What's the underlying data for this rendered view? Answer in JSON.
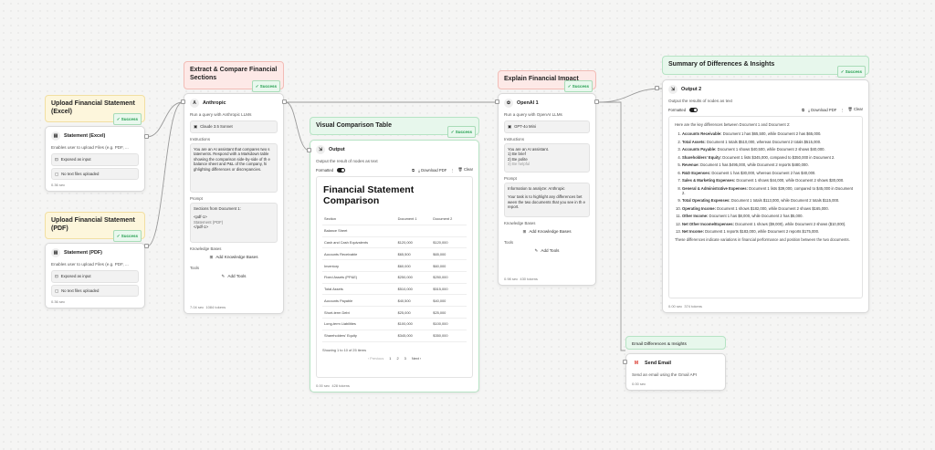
{
  "upload_excel": {
    "header": "Upload Financial Statement (Excel)",
    "badge": "✓ Success",
    "title": "Statement (Excel)",
    "desc": "Enables user to upload Files (e.g. PDF, ...",
    "opt1": "Exposed as input",
    "opt2": "No text files uploaded",
    "time": "0.36 sec"
  },
  "upload_pdf": {
    "header": "Upload Financial Statement (PDF)",
    "badge": "✓ Success",
    "title": "Statement (PDF)",
    "desc": "Enables user to upload Files (e.g. PDF, ...",
    "opt1": "Exposed as input",
    "opt2": "No text files uploaded",
    "time": "0.36 sec"
  },
  "extract": {
    "header": "Extract & Compare Financial Sections",
    "badge": "✓ Success",
    "title": "Anthropic",
    "desc": "Run a query with Anthropic LLMs",
    "model": "Claude 3.5 Sonnet",
    "instructions_label": "Instructions",
    "instructions": "You are an AI assistant that compares two s tatements. Respond with a Markdown table showing the comparison side-by-side of th e balance sheet and P&L of the company, hi ghlighting differences or discrepancies.",
    "prompt_label": "Prompt",
    "prompt_lines": [
      "Sections from Document 1:",
      "<pdf-1>",
      "Statement (PDF)",
      "</pdf-1>"
    ],
    "kb_label": "Knowledge Bases",
    "kb_btn": "Add Knowledge Bases",
    "tools_label": "Tools",
    "tools_btn": "Add Tools",
    "time": "7.04 sec",
    "tokens": "1084 tokens"
  },
  "visual": {
    "header": "Visual Comparison Table",
    "badge": "✓ Success",
    "title": "Output",
    "desc": "Output the result of nodes as text",
    "formatted": "Formatted",
    "download": "Download PDF",
    "clear": "Clear",
    "doc_title": "Financial Statement Comparison",
    "columns": [
      "Section",
      "Document 1",
      "Document 2"
    ],
    "rows": [
      [
        "Balance Sheet",
        "",
        ""
      ],
      [
        "Cash and Cash Equivalents",
        "$120,000",
        "$120,000"
      ],
      [
        "Accounts Receivable",
        "$65,500",
        "$65,000"
      ],
      [
        "Inventory",
        "$60,000",
        "$60,000"
      ],
      [
        "Fixed Assets (PP&E)",
        "$250,000",
        "$250,000"
      ],
      [
        "Total Assets",
        "$510,000",
        "$515,000"
      ],
      [
        "Accounts Payable",
        "$40,500",
        "$40,000"
      ],
      [
        "Short-term Debt",
        "$25,000",
        "$25,000"
      ],
      [
        "Long-term Liabilities",
        "$100,000",
        "$100,000"
      ],
      [
        "Shareholders' Equity",
        "$345,000",
        "$350,000"
      ]
    ],
    "showing": "Showing 1 to 10 of 25 items",
    "prev": "‹ Previous",
    "pages": [
      "1",
      "2",
      "3"
    ],
    "next": "Next ›",
    "time": "0.00 sec",
    "tokens": "428 tokens"
  },
  "explain": {
    "header": "Explain Financial Impact",
    "badge": "✓ Success",
    "title": "OpenAI 1",
    "desc": "Run a query with OpenAI LLMs",
    "model": "GPT-4o Mini",
    "instructions_label": "Instructions",
    "instructions_lines": [
      "You are an AI assistant.",
      "1) Be brief",
      "2) Be polite",
      "3) Be helpful"
    ],
    "prompt_label": "Prompt",
    "prompt_lines": [
      "Information to analyze: Anthropic",
      "Your task is to highlight any differences bet ween the two documents that you see in th e report."
    ],
    "kb_label": "Knowledge Bases",
    "kb_btn": "Add Knowledge Bases",
    "tools_label": "Tools",
    "tools_btn": "Add Tools",
    "time": "0.98 sec",
    "tokens": "430 tokens"
  },
  "summary": {
    "header": "Summary of Differences & Insights",
    "badge": "✓ Success",
    "title": "Output 2",
    "desc": "Output the results of nodes as text",
    "formatted": "Formatted",
    "download": "Download PDF",
    "clear": "Clear",
    "intro": "Here are the key differences between Document 1 and Document 2:",
    "items": [
      {
        "b": "Accounts Receivable:",
        "t": " Document 1 has $65,500, while Document 2 has $65,000."
      },
      {
        "b": "Total Assets:",
        "t": " Document 1 totals $510,000, whereas Document 2 totals $515,000."
      },
      {
        "b": "Accounts Payable:",
        "t": " Document 1 shows $40,500, while Document 2 shows $40,000."
      },
      {
        "b": "Shareholders' Equity:",
        "t": " Document 1 lists $345,000, compared to $350,000 in Document 2."
      },
      {
        "b": "Revenue:",
        "t": " Document 1 has $495,000, while Document 2 reports $480,000."
      },
      {
        "b": "R&D Expenses:",
        "t": " Document 1 has $30,000, whereas Document 2 has $40,000."
      },
      {
        "b": "Sales & Marketing Expenses:",
        "t": " Document 1 shows $44,000, while Document 2 shows $30,000."
      },
      {
        "b": "General & Administrative Expenses:",
        "t": " Document 1 lists $39,000, compared to $45,000 in Document 2."
      },
      {
        "b": "Total Operating Expenses:",
        "t": " Document 1 totals $113,000, while Document 2 totals $115,000."
      },
      {
        "b": "Operating Income:",
        "t": " Document 1 shows $182,000, while Document 2 shows $165,000."
      },
      {
        "b": "Other Income:",
        "t": " Document 1 has $8,000, while Document 2 has $5,000."
      },
      {
        "b": "Net Other Income/Expenses:",
        "t": " Document 1 shows ($9,000), while Document 2 shows ($10,000)."
      },
      {
        "b": "Net Income:",
        "t": " Document 1 reports $183,000, while Document 2 reports $175,000."
      }
    ],
    "outro": "These differences indicate variations in financial performance and position between the two documents.",
    "time": "0.00 sec",
    "tokens": "374 tokens"
  },
  "email": {
    "header": "Email Differences & Insights",
    "title": "Send Email",
    "desc": "Send an email using the Gmail API",
    "time": "0.00 sec"
  }
}
